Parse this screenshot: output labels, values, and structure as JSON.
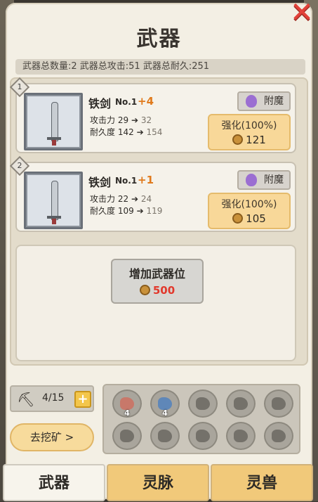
{
  "title": "武器",
  "summary": "武器总数量:2  武器总攻击:51  武器总耐久:251",
  "weapons": [
    {
      "slot": "1",
      "name": "铁剑",
      "no": "No.1",
      "plus": "+4",
      "atk_label": "攻击力",
      "atk_from": "29",
      "atk_to": "32",
      "dur_label": "耐久度",
      "dur_from": "142",
      "dur_to": "154",
      "enchant": "附魔",
      "strengthen": "强化(100%)",
      "cost": "121"
    },
    {
      "slot": "2",
      "name": "铁剑",
      "no": "No.1",
      "plus": "+1",
      "atk_label": "攻击力",
      "atk_from": "22",
      "atk_to": "24",
      "dur_label": "耐久度",
      "dur_from": "109",
      "dur_to": "119",
      "enchant": "附魔",
      "strengthen": "强化(100%)",
      "cost": "105"
    }
  ],
  "add_slot": {
    "label": "增加武器位",
    "cost": "500"
  },
  "mining": {
    "count": "4/15",
    "go_label": "去挖矿 >"
  },
  "ores": [
    {
      "name": "copper-ore",
      "qty": "4",
      "color": "#c8786a"
    },
    {
      "name": "blue-ore",
      "qty": "4",
      "color": "#5f87b8"
    },
    {
      "name": "locked-ore-1",
      "qty": ""
    },
    {
      "name": "locked-ore-2",
      "qty": ""
    },
    {
      "name": "locked-ore-3",
      "qty": ""
    },
    {
      "name": "locked-ore-4",
      "qty": ""
    },
    {
      "name": "locked-ore-5",
      "qty": ""
    },
    {
      "name": "locked-ore-6",
      "qty": ""
    },
    {
      "name": "locked-ore-7",
      "qty": ""
    },
    {
      "name": "locked-ore-8",
      "qty": ""
    }
  ],
  "tabs": [
    "武器",
    "灵脉",
    "灵兽"
  ],
  "colors": {
    "accent": "#e07a1c",
    "cost_red": "#e2382c",
    "tab_gold": "#f1c97a"
  }
}
